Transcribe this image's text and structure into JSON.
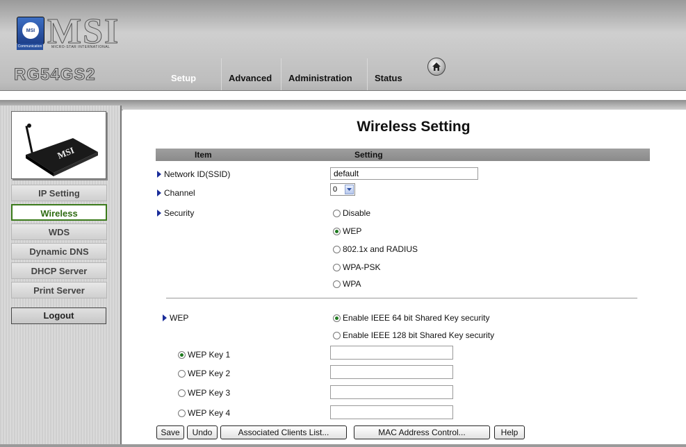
{
  "header": {
    "logo_text": "MSI",
    "logo_subtext": "MICRO-STAR INTERNATIONAL",
    "logo_badge": "Communication",
    "model": "RG54GS2",
    "tabs": [
      {
        "label": "Setup",
        "active": true
      },
      {
        "label": "Advanced",
        "active": false
      },
      {
        "label": "Administration",
        "active": false
      },
      {
        "label": "Status",
        "active": false
      }
    ],
    "home_icon": "home-icon"
  },
  "sidebar": {
    "device_label": "MSI",
    "items": [
      {
        "label": "IP Setting",
        "active": false
      },
      {
        "label": "Wireless",
        "active": true
      },
      {
        "label": "WDS",
        "active": false
      },
      {
        "label": "Dynamic DNS",
        "active": false
      },
      {
        "label": "DHCP Server",
        "active": false
      },
      {
        "label": "Print Server",
        "active": false
      }
    ],
    "logout": "Logout"
  },
  "main": {
    "title": "Wireless Setting",
    "columns": {
      "item": "Item",
      "setting": "Setting"
    },
    "ssid": {
      "label": "Network ID(SSID)",
      "value": "default"
    },
    "channel": {
      "label": "Channel",
      "value": "0"
    },
    "security": {
      "label": "Security",
      "options": [
        "Disable",
        "WEP",
        "802.1x and RADIUS",
        "WPA-PSK",
        "WPA"
      ],
      "selected": "WEP"
    },
    "wep": {
      "label": "WEP",
      "options": [
        "Enable IEEE 64 bit Shared Key security",
        "Enable IEEE 128 bit Shared Key security"
      ],
      "selected": "Enable IEEE 64 bit Shared Key security",
      "keys": [
        {
          "label": "WEP Key 1",
          "selected": true,
          "value": ""
        },
        {
          "label": "WEP Key 2",
          "selected": false,
          "value": ""
        },
        {
          "label": "WEP Key 3",
          "selected": false,
          "value": ""
        },
        {
          "label": "WEP Key 4",
          "selected": false,
          "value": ""
        }
      ]
    },
    "buttons": {
      "save": "Save",
      "undo": "Undo",
      "clients": "Associated Clients List...",
      "mac": "MAC Address Control...",
      "help": "Help"
    }
  },
  "colors": {
    "active_menu": "#2e6b11",
    "arrow": "#1a2d9a",
    "radio_dot": "#1f7a1f"
  }
}
